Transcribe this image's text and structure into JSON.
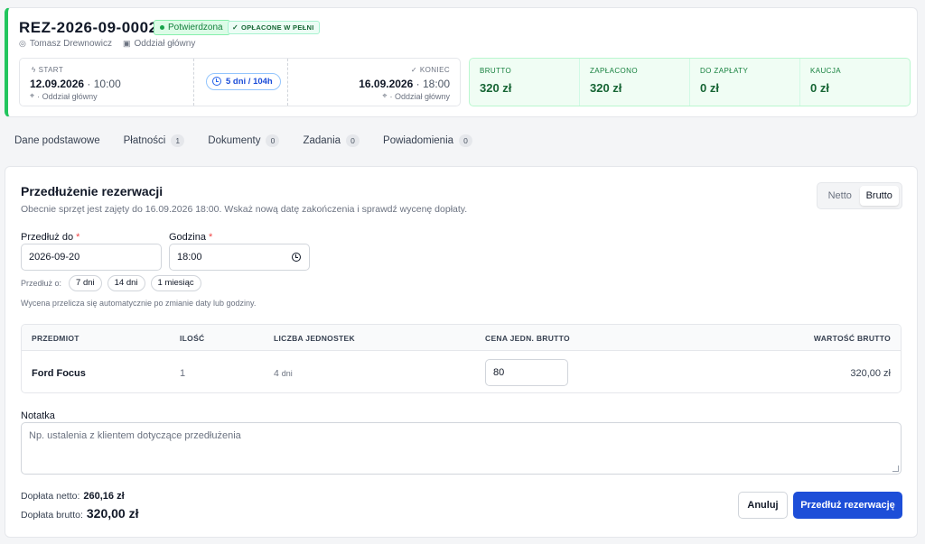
{
  "header": {
    "reservation_id": "REZ-2026-09-0002",
    "status_badge": "Potwierdzona",
    "payment_badge": "OPŁACONE W PEŁNI",
    "customer": "Tomasz Drewnowicz",
    "branch": "Oddział główny"
  },
  "dates": {
    "start_label": "START",
    "start_date": "12.09.2026",
    "start_time": "10:00",
    "start_location": "· Oddział główny",
    "duration": "5 dni / 104h",
    "end_label": "KONIEC",
    "end_date": "16.09.2026",
    "end_time": "18:00",
    "end_location": "· Oddział główny"
  },
  "totals": [
    {
      "label": "BRUTTO",
      "value": "320 zł"
    },
    {
      "label": "ZAPŁACONO",
      "value": "320 zł"
    },
    {
      "label": "DO ZAPŁATY",
      "value": "0 zł"
    },
    {
      "label": "KAUCJA",
      "value": "0 zł"
    }
  ],
  "tabs": [
    {
      "label": "Dane podstawowe",
      "count": ""
    },
    {
      "label": "Płatności",
      "count": "1"
    },
    {
      "label": "Dokumenty",
      "count": "0"
    },
    {
      "label": "Zadania",
      "count": "0"
    },
    {
      "label": "Powiadomienia",
      "count": "0"
    }
  ],
  "extension": {
    "title": "Przedłużenie rezerwacji",
    "description": "Obecnie sprzęt jest zajęty do 16.09.2026 18:00. Wskaż nową datę zakończenia i sprawdź wycenę dopłaty.",
    "toggle_netto": "Netto",
    "toggle_brutto": "Brutto",
    "date_label": "Przedłuż do",
    "date_value": "2026-09-20",
    "time_label": "Godzina",
    "time_value": "18:00",
    "required_mark": "*",
    "extend_by_label": "Przedłuż o:",
    "quick_options": [
      "7 dni",
      "14 dni",
      "1 miesiąc"
    ],
    "hint": "Wycena przelicza się automatycznie po zmianie daty lub godziny."
  },
  "table": {
    "headers": [
      "PRZEDMIOT",
      "ILOŚĆ",
      "LICZBA JEDNOSTEK",
      "CENA JEDN. BRUTTO",
      "WARTOŚĆ BRUTTO"
    ],
    "rows": [
      {
        "item": "Ford Focus",
        "qty": "1",
        "units": "4",
        "units_suffix": "dni",
        "unit_price": "80",
        "value": "320,00 zł"
      }
    ]
  },
  "note": {
    "label": "Notatka",
    "placeholder": "Np. ustalenia z klientem dotyczące przedłużenia"
  },
  "summary": {
    "net_label": "Dopłata netto:",
    "net_value": "260,16 zł",
    "gross_label": "Dopłata brutto:",
    "gross_value": "320,00 zł"
  },
  "actions": {
    "cancel": "Anuluj",
    "extend": "Przedłuż rezerwację"
  },
  "colors": {
    "accent_green": "#22c55e",
    "primary_blue": "#1d4ed8",
    "required_red": "#ef4444"
  }
}
